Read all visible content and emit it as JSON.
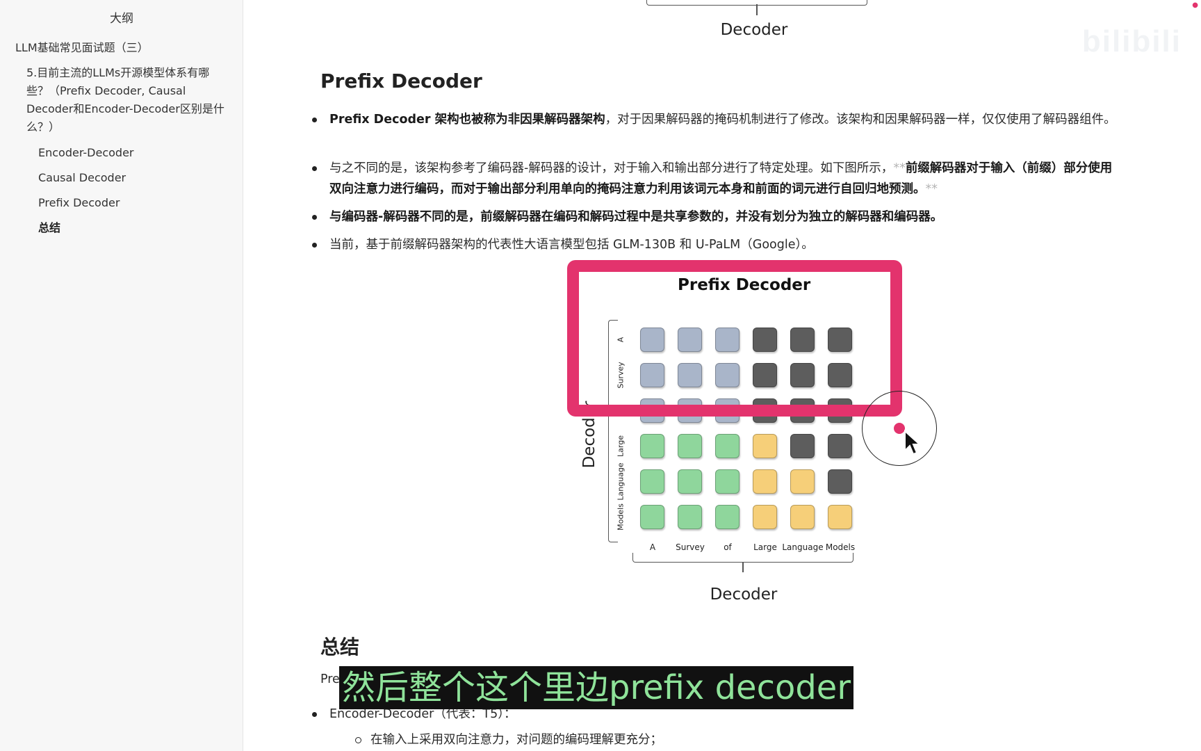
{
  "sidebar": {
    "title": "大纲",
    "items": [
      {
        "label": "LLM基础常见面试题（三）",
        "level": 1
      },
      {
        "label": "5.目前主流的LLMs开源模型体系有哪些？（Prefix Decoder, Causal Decoder和Encoder-Decoder区别是什么？）",
        "level": 2
      },
      {
        "label": "Encoder-Decoder",
        "level": 3
      },
      {
        "label": "Causal Decoder",
        "level": 3
      },
      {
        "label": "Prefix Decoder",
        "level": 3
      },
      {
        "label": "总结",
        "level": 3,
        "active": true
      }
    ]
  },
  "top_figure": {
    "decoder_label": "Decoder"
  },
  "watermark": "bilibili",
  "section_prefix": {
    "heading": "Prefix Decoder",
    "bullets": [
      {
        "bold_lead": "Prefix Decoder 架构也被称为非因果解码器架构",
        "text": "，对于因果解码器的掩码机制进行了修改。该架构和因果解码器一样，仅仅使用了解码器组件。"
      },
      {
        "text": "与之不同的是，该架构参考了编码器-解码器的设计，对于输入和输出部分进行了特定处理。如下图所示，",
        "faint_open": "**",
        "bold": "前缀解码器对于输入（前缀）部分使用双向注意力进行编码，而对于输出部分利用单向的掩码注意力利用该词元本身和前面的词元进行自回归地预测。",
        "faint_close": "**"
      },
      {
        "bold": "与编码器-解码器不同的是，前缀解码器在编码和解码过程中是共享参数的，并没有划分为独立的解码器和编码器。"
      },
      {
        "text": "当前，基于前缀解码器架构的代表性大语言模型包括 GLM-130B 和 U-PaLM（Google）。"
      }
    ]
  },
  "figure": {
    "title": "Prefix Decoder",
    "row_labels": [
      "A",
      "Survey",
      "of",
      "Large",
      "Language",
      "Models"
    ],
    "col_labels": [
      "A",
      "Survey",
      "of",
      "Large",
      "Language",
      "Models"
    ],
    "left_label": "Decoder",
    "bottom_label": "Decoder",
    "grid": [
      [
        "blue",
        "blue",
        "blue",
        "dark",
        "dark",
        "dark"
      ],
      [
        "blue",
        "blue",
        "blue",
        "dark",
        "dark",
        "dark"
      ],
      [
        "blue",
        "blue",
        "blue",
        "dark",
        "dark",
        "dark"
      ],
      [
        "green",
        "green",
        "green",
        "yellow",
        "dark",
        "dark"
      ],
      [
        "green",
        "green",
        "green",
        "yellow",
        "yellow",
        "dark"
      ],
      [
        "green",
        "green",
        "green",
        "yellow",
        "yellow",
        "yellow"
      ]
    ],
    "colors": {
      "blue": "#a9b5c9",
      "dark": "#5d5d5d",
      "green": "#8fd69c",
      "yellow": "#f6cf79",
      "highlight": "#e3336d"
    }
  },
  "section_summary": {
    "heading": "总结",
    "partial_line": "Pre",
    "bullet_1": "Encoder-Decoder（代表：T5）：",
    "sub_bullet_1": "在输入上采用双向注意力，对问题的编码理解更充分；"
  },
  "subtitle": "然后整个这个里边prefix decoder"
}
